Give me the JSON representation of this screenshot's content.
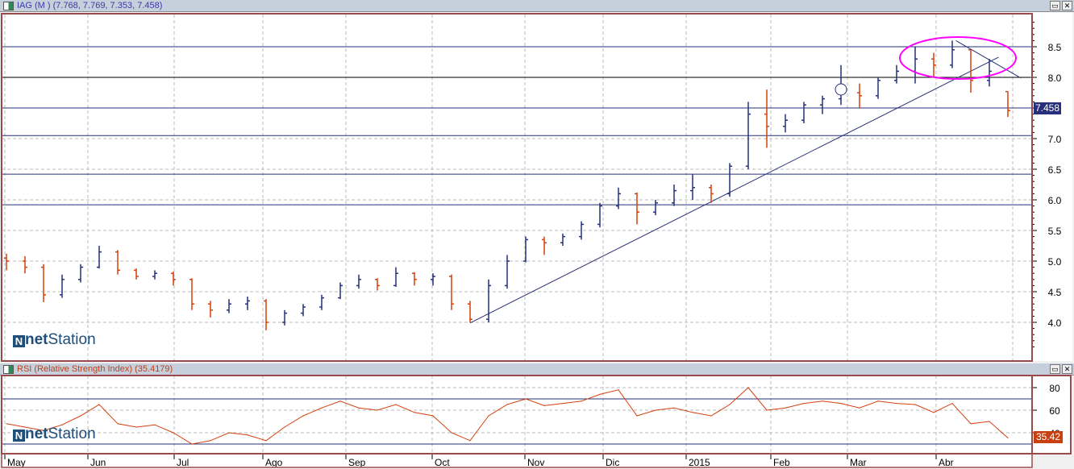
{
  "price_panel": {
    "title": "IAG (M ) (7.768, 7.769, 7.353, 7.458)",
    "last_price_label": "7.458",
    "logo": "netStation"
  },
  "rsi_panel": {
    "title": "RSI (Relative Strength Index) (35.4179)",
    "last_value_label": "35.42",
    "logo": "netStation"
  },
  "window_buttons": {
    "restore": "▭",
    "close": "✕"
  },
  "colors": {
    "up": "#26307a",
    "down": "#d4400f",
    "rsi": "#d4400f",
    "ellipse": "#ff00ff",
    "hline": "#26307a",
    "axis_border": "#9a4a4a",
    "last_price_bg": "#26307a",
    "last_rsi_bg": "#c8400f"
  },
  "chart_data": [
    {
      "type": "ohlc",
      "title": "IAG (M )",
      "x_tick_labels": [
        "May",
        "Jun",
        "Jul",
        "Ago",
        "Sep",
        "Oct",
        "Nov",
        "Dic",
        "2015",
        "Feb",
        "Mar",
        "Abr"
      ],
      "y_tick_labels": [
        "4.0",
        "4.5",
        "5.0",
        "5.5",
        "6.0",
        "6.5",
        "7.0",
        "7.5",
        "8.0",
        "8.5"
      ],
      "ylim": [
        3.6,
        8.9
      ],
      "grid": true,
      "bars": [
        [
          5.05,
          5.12,
          4.85,
          5.0
        ],
        [
          5.0,
          5.08,
          4.8,
          4.9
        ],
        [
          4.9,
          4.95,
          4.33,
          4.45
        ],
        [
          4.45,
          4.78,
          4.4,
          4.7
        ],
        [
          4.7,
          4.95,
          4.65,
          4.9
        ],
        [
          4.9,
          5.25,
          4.88,
          5.15
        ],
        [
          5.15,
          5.18,
          4.78,
          4.85
        ],
        [
          4.85,
          4.88,
          4.7,
          4.75
        ],
        [
          4.75,
          4.85,
          4.7,
          4.8
        ],
        [
          4.8,
          4.83,
          4.6,
          4.7
        ],
        [
          4.7,
          4.72,
          4.2,
          4.3
        ],
        [
          4.3,
          4.35,
          4.08,
          4.2
        ],
        [
          4.2,
          4.38,
          4.15,
          4.3
        ],
        [
          4.3,
          4.42,
          4.2,
          4.35
        ],
        [
          4.35,
          4.38,
          3.87,
          4.0
        ],
        [
          4.0,
          4.2,
          3.95,
          4.15
        ],
        [
          4.15,
          4.3,
          4.1,
          4.25
        ],
        [
          4.25,
          4.45,
          4.2,
          4.4
        ],
        [
          4.4,
          4.65,
          4.38,
          4.6
        ],
        [
          4.6,
          4.78,
          4.55,
          4.7
        ],
        [
          4.7,
          4.72,
          4.52,
          4.6
        ],
        [
          4.6,
          4.9,
          4.58,
          4.8
        ],
        [
          4.8,
          4.82,
          4.6,
          4.7
        ],
        [
          4.7,
          4.8,
          4.6,
          4.75
        ],
        [
          4.75,
          4.78,
          4.2,
          4.3
        ],
        [
          4.3,
          4.35,
          4.0,
          4.05
        ],
        [
          4.05,
          4.7,
          4.0,
          4.6
        ],
        [
          4.6,
          5.1,
          4.55,
          5.0
        ],
        [
          5.0,
          5.4,
          4.98,
          5.35
        ],
        [
          5.35,
          5.4,
          5.1,
          5.3
        ],
        [
          5.3,
          5.45,
          5.25,
          5.4
        ],
        [
          5.4,
          5.65,
          5.35,
          5.6
        ],
        [
          5.6,
          5.95,
          5.55,
          5.9
        ],
        [
          5.9,
          6.2,
          5.85,
          6.1
        ],
        [
          6.1,
          6.12,
          5.6,
          5.8
        ],
        [
          5.8,
          6.0,
          5.75,
          5.95
        ],
        [
          5.95,
          6.25,
          5.9,
          6.15
        ],
        [
          6.15,
          6.42,
          6.0,
          6.2
        ],
        [
          6.2,
          6.25,
          5.95,
          6.1
        ],
        [
          6.1,
          6.6,
          6.05,
          6.55
        ],
        [
          6.55,
          7.6,
          6.5,
          7.4
        ],
        [
          7.4,
          7.8,
          6.85,
          7.2
        ],
        [
          7.2,
          7.4,
          7.1,
          7.3
        ],
        [
          7.3,
          7.6,
          7.25,
          7.55
        ],
        [
          7.55,
          7.7,
          7.4,
          7.65
        ],
        [
          7.65,
          8.2,
          7.55,
          7.75
        ],
        [
          7.75,
          7.9,
          7.5,
          7.7
        ],
        [
          7.7,
          8.0,
          7.65,
          7.95
        ],
        [
          7.95,
          8.2,
          7.9,
          8.1
        ],
        [
          8.1,
          8.5,
          7.9,
          8.3
        ],
        [
          8.3,
          8.4,
          8.0,
          8.2
        ],
        [
          8.2,
          8.6,
          8.15,
          8.45
        ],
        [
          8.45,
          8.45,
          7.75,
          7.95
        ],
        [
          7.95,
          8.3,
          7.85,
          8.1
        ],
        [
          7.768,
          7.769,
          7.353,
          7.458
        ]
      ],
      "horizontal_lines": [
        8.5,
        8.0,
        7.5,
        7.05,
        6.42,
        5.92
      ],
      "trendlines": [
        {
          "from": [
            25,
            3.99
          ],
          "to": [
            53.5,
            8.33
          ]
        },
        {
          "from": [
            51.2,
            8.6
          ],
          "to": [
            54.7,
            7.99
          ]
        }
      ]
    },
    {
      "type": "line",
      "title": "RSI (Relative Strength Index)",
      "y_tick_labels": [
        "40",
        "60",
        "80"
      ],
      "ylim": [
        22,
        92
      ],
      "reference_lines": [
        70,
        30
      ],
      "grid": true,
      "values": [
        48,
        45,
        42,
        47,
        55,
        65,
        48,
        45,
        47,
        40,
        30,
        33,
        40,
        38,
        33,
        45,
        55,
        62,
        68,
        62,
        60,
        65,
        58,
        55,
        40,
        33,
        55,
        65,
        70,
        64,
        66,
        68,
        74,
        78,
        55,
        60,
        62,
        58,
        55,
        65,
        80,
        60,
        62,
        66,
        68,
        66,
        62,
        68,
        66,
        65,
        58,
        66,
        48,
        50,
        35.42
      ]
    }
  ]
}
